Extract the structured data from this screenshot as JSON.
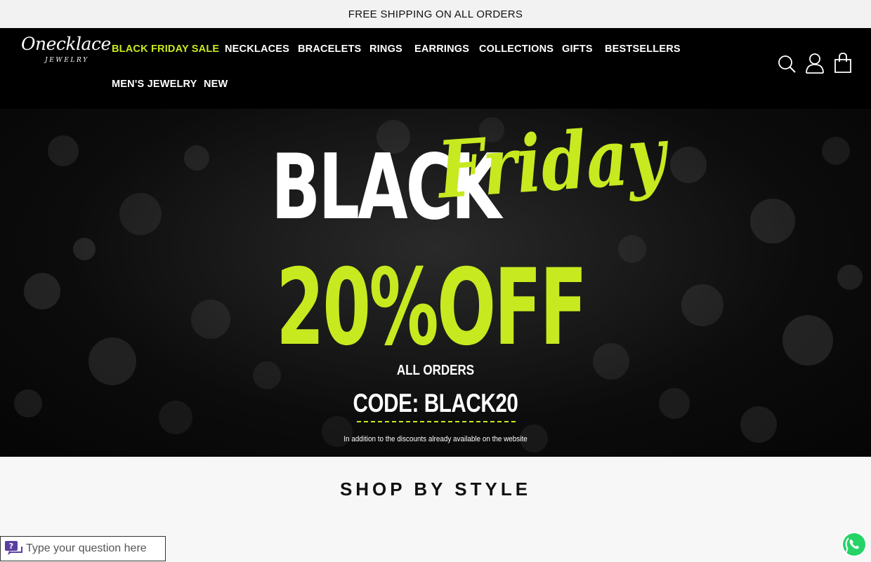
{
  "announcement": "FREE SHIPPING ON ALL ORDERS",
  "brand": {
    "script": "Onecklace",
    "sub": "JEWELRY"
  },
  "nav": [
    {
      "label": "BLACK FRIDAY SALE"
    },
    {
      "label": "NECKLACES"
    },
    {
      "label": "BRACELETS"
    },
    {
      "label": "RINGS"
    },
    {
      "label": "EARRINGS"
    },
    {
      "label": "COLLECTIONS"
    },
    {
      "label": "GIFTS"
    },
    {
      "label": "BESTSELLERS"
    },
    {
      "label": "MEN'S JEWELRY"
    },
    {
      "label": "NEW"
    }
  ],
  "header_icons": [
    "search-icon",
    "account-icon",
    "cart-icon"
  ],
  "hero": {
    "black": "BLACK",
    "friday": "Friday",
    "discount": "20%OFF",
    "all_orders": "ALL ORDERS",
    "code": "CODE: BLACK20",
    "note": "In addition to the discounts already available on the website"
  },
  "section_title": "SHOP BY STYLE",
  "chat": {
    "placeholder": "Type your question here"
  },
  "colors": {
    "accent": "#c6ea1f",
    "header_bg": "#000000",
    "announce_bg": "#f2f2f2",
    "whatsapp": "#25d366"
  }
}
